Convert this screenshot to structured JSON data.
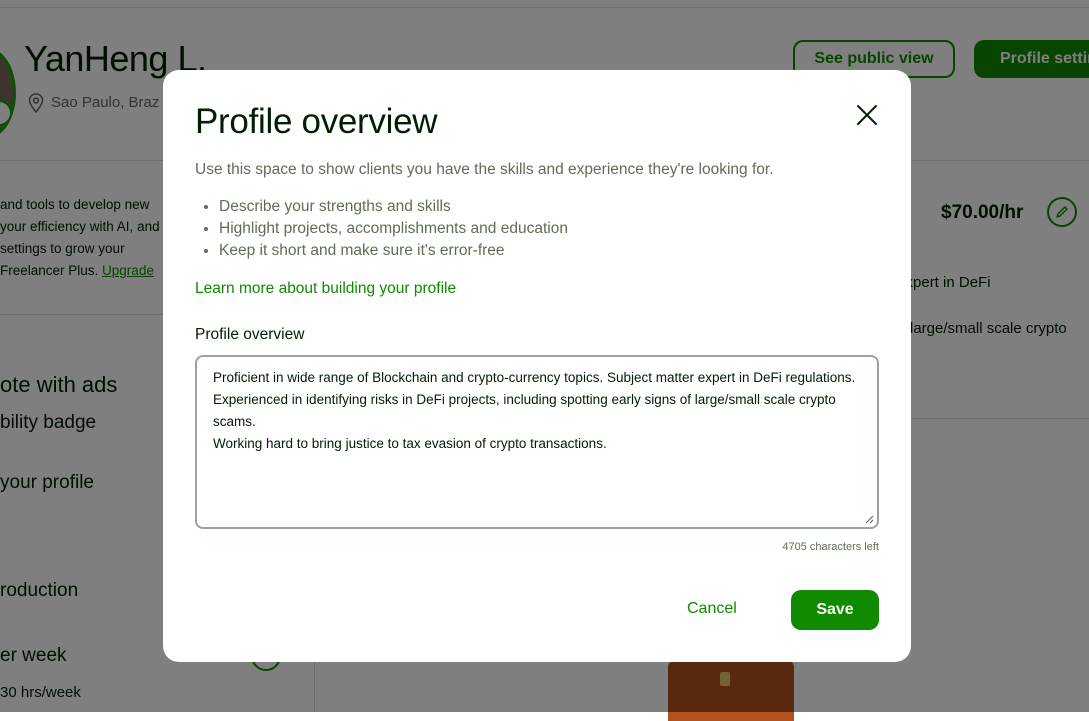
{
  "background": {
    "name": "YanHeng L.",
    "location": "Sao Paulo, Braz",
    "see_public_view": "See public view",
    "profile_settings": "Profile settin",
    "left_para": [
      "and tools to develop new",
      "your efficiency with AI, and",
      " settings to grow your",
      "Freelancer Plus. "
    ],
    "upgrade": "Upgrade",
    "promote": "ote with ads",
    "badge": "bility badge",
    "your_profile": " your profile",
    "production": "roduction",
    "per_week": "er week",
    "hours": "30 hrs/week",
    "rate": "$70.00/hr",
    "right_line1": "r expert in DeFi",
    "right_line2": "large/small scale crypto"
  },
  "modal": {
    "title": "Profile overview",
    "description": "Use this space to show clients you have the skills and experience they're looking for.",
    "tips": [
      "Describe your strengths and skills",
      "Highlight projects, accomplishments and education",
      "Keep it short and make sure it's error-free"
    ],
    "learn_more": "Learn more about building your profile",
    "field_label": "Profile overview",
    "overview_value": "Proficient in wide range of Blockchain and crypto-currency topics. Subject matter expert in DeFi regulations.\nExperienced in identifying risks in DeFi projects, including spotting early signs of large/small scale crypto scams.\nWorking hard to bring justice to tax evasion of crypto transactions.",
    "chars_left": "4705 characters left",
    "cancel": "Cancel",
    "save": "Save"
  },
  "colors": {
    "brand_green": "#108a00",
    "overlay": "rgba(0,0,0,0.5)",
    "text_muted": "#5e6d55"
  },
  "icons": {
    "close": "close-icon",
    "location": "location-pin-icon",
    "edit": "pencil-icon",
    "resize": "resize-grip-icon"
  }
}
